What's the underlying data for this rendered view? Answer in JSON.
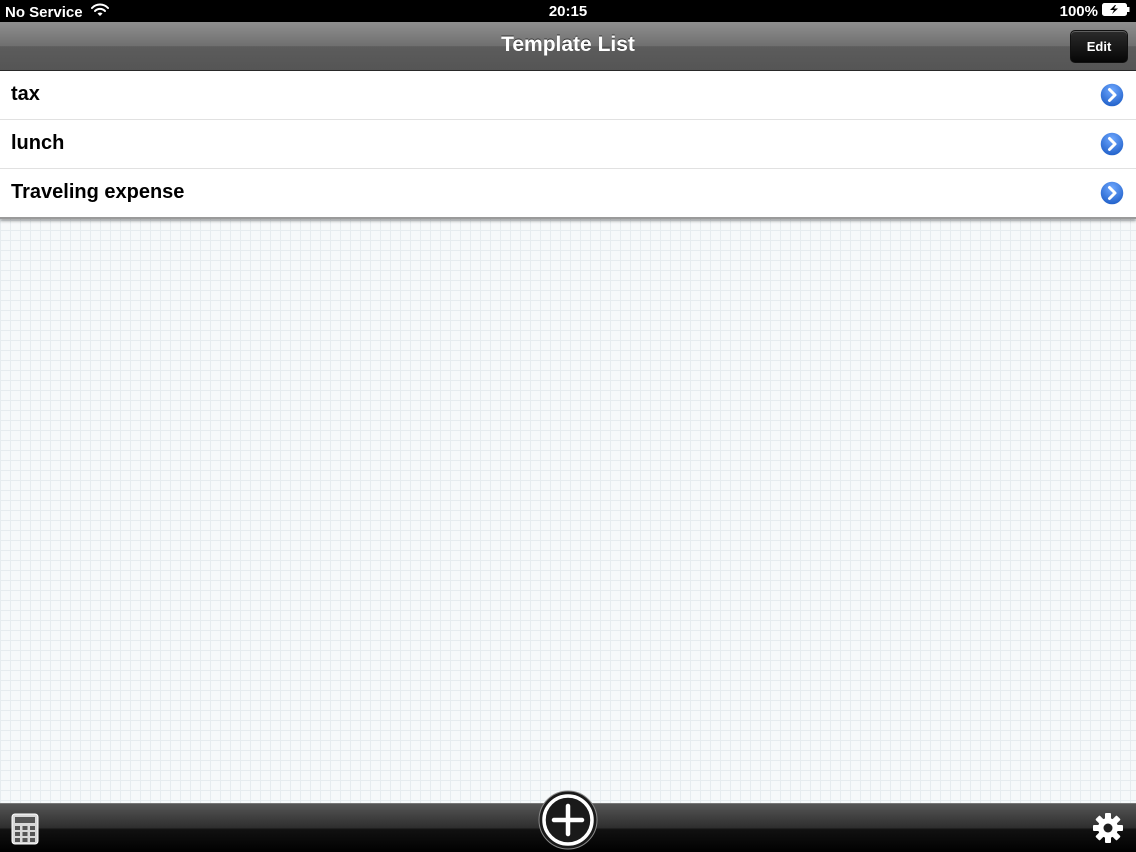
{
  "status_bar": {
    "carrier": "No Service",
    "time": "20:15",
    "battery": "100%"
  },
  "nav_bar": {
    "title": "Template List",
    "edit_label": "Edit"
  },
  "templates": [
    {
      "name": "tax"
    },
    {
      "name": "lunch"
    },
    {
      "name": "Traveling expense"
    }
  ],
  "icons": {
    "status": [
      "wifi-icon",
      "battery-icon"
    ],
    "row": "disclosure-chevron-icon",
    "toolbar": [
      "calculator-icon",
      "add-plus-icon",
      "gear-icon"
    ]
  },
  "colors": {
    "disclosure_blue": "#2f6fd6",
    "nav_bar": "#6f6f6f",
    "toolbar": "#1c1c1c"
  }
}
